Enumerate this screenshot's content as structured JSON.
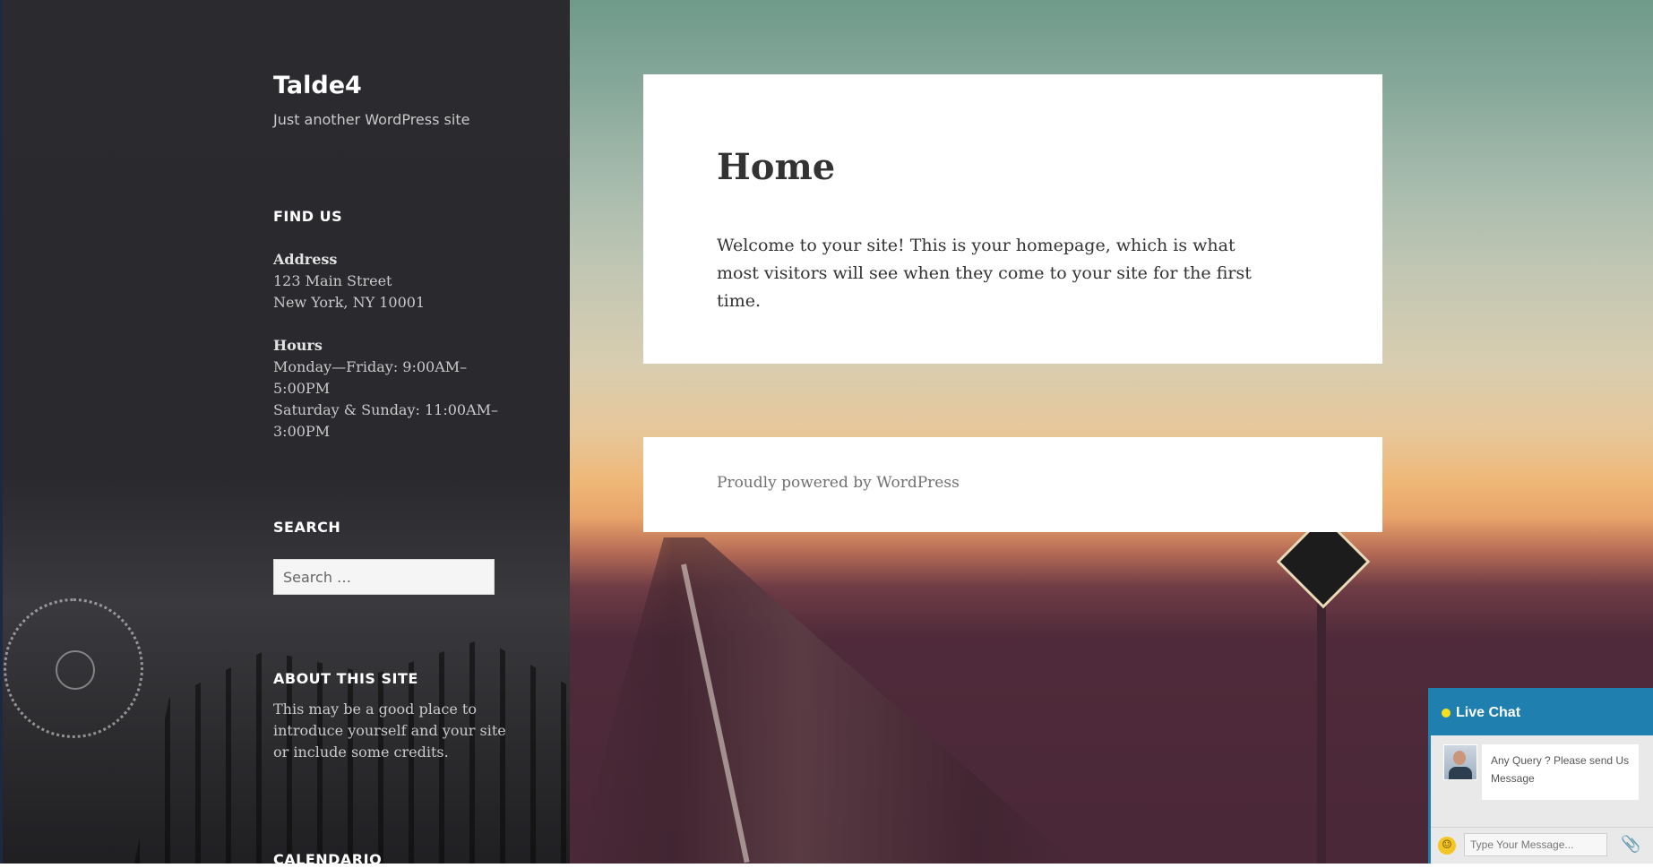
{
  "site": {
    "title": "Talde4",
    "description": "Just another WordPress site"
  },
  "sidebar": {
    "find_us": {
      "title": "FIND US",
      "address_label": "Address",
      "address_line1": "123 Main Street",
      "address_line2": "New York, NY 10001",
      "hours_label": "Hours",
      "hours_line1": "Monday—Friday: 9:00AM–",
      "hours_line2": "5:00PM",
      "hours_line3": "Saturday & Sunday: 11:00AM–",
      "hours_line4": "3:00PM"
    },
    "search": {
      "title": "SEARCH",
      "placeholder": "Search …"
    },
    "about": {
      "title": "ABOUT THIS SITE",
      "text": "This may be a good place to introduce yourself and your site or include some credits."
    },
    "calendar": {
      "title": "CALENDARIO"
    }
  },
  "main": {
    "page_title": "Home",
    "page_body": "Welcome to your site! This is your homepage, which is what most visitors will see when they come to your site for the first time."
  },
  "footer": {
    "powered_by": "Proudly powered by WordPress"
  },
  "chat": {
    "header": "Live Chat",
    "status_color": "#f7e11d",
    "accent_color": "#1f7fae",
    "greeting": "Any Query ? Please send Us Message",
    "input_placeholder": "Type Your Message...",
    "emoji_icon": "smiley-icon",
    "attach_icon": "paperclip-icon"
  }
}
